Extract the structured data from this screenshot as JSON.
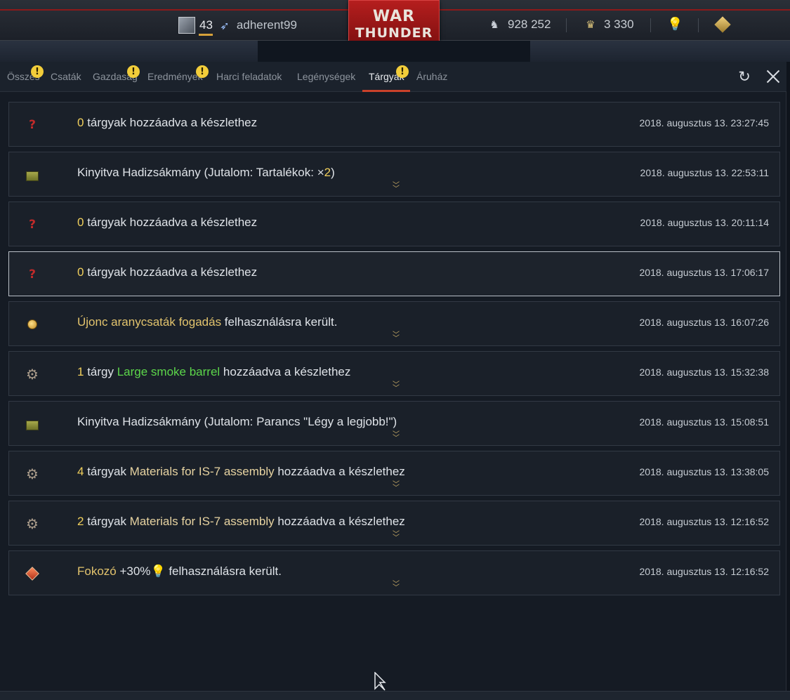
{
  "header": {
    "player_level": "43",
    "username": "adherent99",
    "logo_line1": "WAR",
    "logo_line2": "THUNDER",
    "silver_lions": "928 252",
    "golden_eagles": "3 330"
  },
  "tabs": [
    {
      "label": "Összes",
      "alert": "!"
    },
    {
      "label": "Csaták",
      "alert": ""
    },
    {
      "label": "Gazdaság",
      "alert": "!"
    },
    {
      "label": "Eredmények",
      "alert": "!"
    },
    {
      "label": "Harci feladatok",
      "alert": ""
    },
    {
      "label": "Legénységek",
      "alert": ""
    },
    {
      "label": "Tárgyak",
      "alert": "!",
      "active": true
    },
    {
      "label": "Áruház",
      "alert": ""
    }
  ],
  "rows": [
    {
      "icon": "question-icon",
      "parts": [
        [
          "0",
          "yellow"
        ],
        [
          " tárgyak  hozzáadva a készlethez",
          ""
        ]
      ],
      "date": "2018. augusztus 13. 23:27:45",
      "expand": false
    },
    {
      "icon": "chest-icon",
      "parts": [
        [
          "Kinyitva Hadizsákmány  (Jutalom: Tartalékok: ×",
          ""
        ],
        [
          "2",
          "yellow"
        ],
        [
          ")",
          ""
        ]
      ],
      "date": "2018. augusztus 13. 22:53:11",
      "expand": true
    },
    {
      "icon": "question-icon",
      "parts": [
        [
          "0",
          "yellow"
        ],
        [
          " tárgyak  hozzáadva a készlethez",
          ""
        ]
      ],
      "date": "2018. augusztus 13. 20:11:14",
      "expand": false
    },
    {
      "icon": "question-icon",
      "parts": [
        [
          "0",
          "yellow"
        ],
        [
          " tárgyak  hozzáadva a készlethez",
          ""
        ]
      ],
      "date": "2018. augusztus 13. 17:06:17",
      "expand": false,
      "selected": true
    },
    {
      "icon": "medal-icon",
      "parts": [
        [
          "Újonc aranycsaták fogadás",
          "gold"
        ],
        [
          " felhasználásra került.",
          ""
        ]
      ],
      "date": "2018. augusztus 13. 16:07:26",
      "expand": true
    },
    {
      "icon": "gear-icon",
      "parts": [
        [
          "1",
          "yellow"
        ],
        [
          " tárgy ",
          ""
        ],
        [
          "Large smoke barrel",
          "green"
        ],
        [
          " hozzáadva a készlethez",
          ""
        ]
      ],
      "date": "2018. augusztus 13. 15:32:38",
      "expand": true
    },
    {
      "icon": "chest-icon",
      "parts": [
        [
          "Kinyitva Hadizsákmány  (Jutalom: Parancs \"Légy a legjobb!\")",
          ""
        ]
      ],
      "date": "2018. augusztus 13. 15:08:51",
      "expand": true
    },
    {
      "icon": "gear-icon",
      "parts": [
        [
          "4",
          "yellow"
        ],
        [
          " tárgyak ",
          ""
        ],
        [
          "Materials for IS-7 assembly",
          "sand"
        ],
        [
          " hozzáadva a készlethez",
          ""
        ]
      ],
      "date": "2018. augusztus 13. 13:38:05",
      "expand": true
    },
    {
      "icon": "gear-icon",
      "parts": [
        [
          "2",
          "yellow"
        ],
        [
          " tárgyak ",
          ""
        ],
        [
          "Materials for IS-7 assembly",
          "sand"
        ],
        [
          " hozzáadva a készlethez",
          ""
        ]
      ],
      "date": "2018. augusztus 13. 12:16:52",
      "expand": true
    },
    {
      "icon": "booster-icon",
      "parts": [
        [
          "Fokozó",
          "gold"
        ],
        [
          " +30%",
          ""
        ],
        [
          "💡",
          "blue"
        ],
        [
          " felhasználásra került.",
          ""
        ]
      ],
      "date": "2018. augusztus 13. 12:16:52",
      "expand": true
    }
  ],
  "colors": {
    "accent_red": "#c9412a",
    "highlight_yellow": "#f0cf5c",
    "highlight_green": "#5cd64a"
  }
}
